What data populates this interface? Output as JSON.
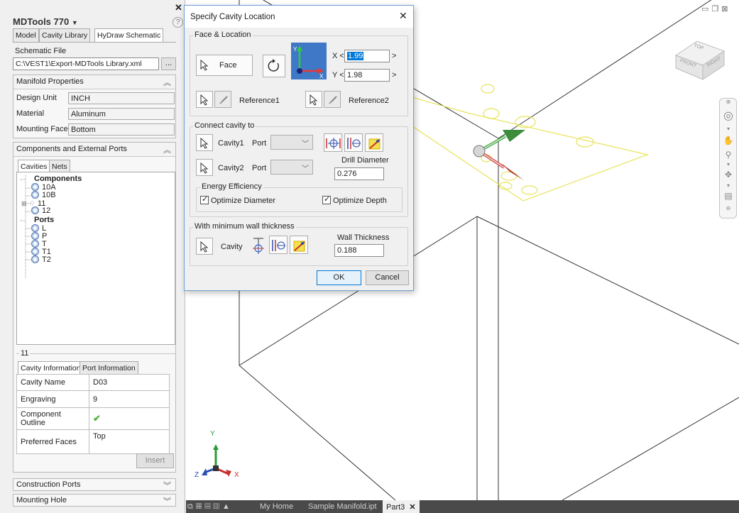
{
  "panel": {
    "title": "MDTools 770",
    "tabs": [
      "Model",
      "Cavity Library",
      "HyDraw Schematic"
    ],
    "schematic_file_label": "Schematic File",
    "schematic_file_path": "C:\\VEST1\\Export-MDTools Library.xml",
    "browse_label": "...",
    "manifold_properties": {
      "header": "Manifold Properties",
      "rows": [
        {
          "label": "Design Unit",
          "value": "INCH"
        },
        {
          "label": "Material",
          "value": "Aluminum"
        },
        {
          "label": "Mounting Face",
          "value": "Bottom"
        }
      ]
    },
    "components_header": "Components and External Ports",
    "subtabs": [
      "Cavities",
      "Nets"
    ],
    "tree": {
      "components_label": "Components",
      "components": [
        "10A",
        "10B",
        "11",
        "12"
      ],
      "ports_label": "Ports",
      "ports": [
        "L",
        "P",
        "T",
        "T1",
        "T2"
      ]
    },
    "selected_label": "11",
    "info_tabs": [
      "Cavity Information",
      "Port Information"
    ],
    "info_rows": [
      {
        "label": "Cavity Name",
        "value": "D03"
      },
      {
        "label": "Engraving",
        "value": "9"
      },
      {
        "label": "Component Outline",
        "value": ""
      },
      {
        "label": "Preferred Faces",
        "value": "Top"
      }
    ],
    "insert_label": "Insert",
    "construction_ports": "Construction Ports",
    "mounting_hole": "Mounting Hole"
  },
  "dialog": {
    "title": "Specify Cavity Location",
    "face_location": "Face & Location",
    "face_label": "Face",
    "x_label": "X <",
    "x_value": "1.99",
    "y_label": "Y <",
    "y_value": "1.98",
    "arrow_right": ">",
    "reference1": "Reference1",
    "reference2": "Reference2",
    "connect_label": "Connect cavity to",
    "cavity1": "Cavity1",
    "cavity2": "Cavity2",
    "port_label": "Port",
    "drill_diameter_label": "Drill Diameter",
    "drill_diameter": "0.276",
    "energy_label": "Energy Efficiency",
    "optimize_diameter": "Optimize Diameter",
    "optimize_depth": "Optimize Depth",
    "wall_group_label": "With minimum wall thickness",
    "cavity_label": "Cavity",
    "wall_thickness_label": "Wall Thickness",
    "wall_thickness": "0.188",
    "ok": "OK",
    "cancel": "Cancel"
  },
  "viewcube": {
    "top": "TOP",
    "front": "FRONT",
    "right": "RIGHT"
  },
  "axis": {
    "x": "X",
    "y": "Y",
    "z": "Z"
  },
  "bottom_tabs": [
    "My Home",
    "Sample Manifold.ipt",
    "Part3"
  ],
  "colors": {
    "accent": "#0078d7",
    "sketch": "#e8e35a",
    "x_axis": "#c8302e",
    "y_axis": "#2f9a3a",
    "z_axis": "#2c4fb0"
  }
}
